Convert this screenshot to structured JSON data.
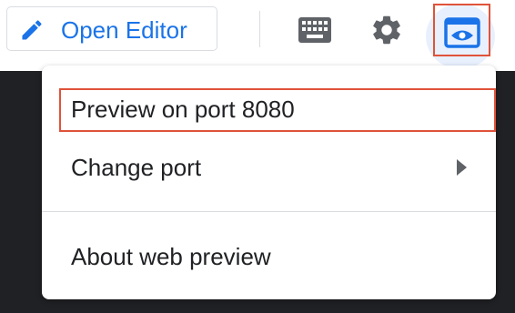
{
  "toolbar": {
    "open_editor_label": "Open Editor",
    "open_editor_icon": "pencil-icon",
    "keyboard_icon": "keyboard-icon",
    "settings_icon": "gear-icon",
    "web_preview_icon": "web-preview-icon",
    "accent_color": "#1a73e8"
  },
  "menu": {
    "items": [
      {
        "label": "Preview on port 8080"
      },
      {
        "label": "Change port",
        "submenu_icon": "chevron-right-icon"
      },
      {
        "label": "About web preview"
      }
    ]
  },
  "annotation_color": "#e0533a"
}
